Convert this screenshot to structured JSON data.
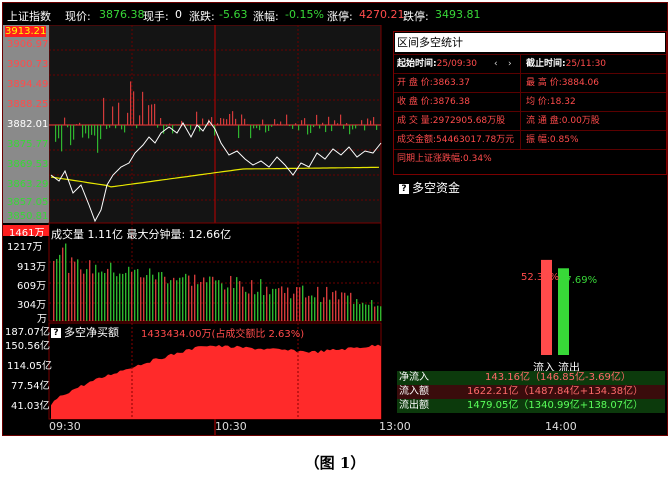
{
  "header": {
    "index_name": "上证指数",
    "price_label": "现价:",
    "price": "3876.38",
    "hand_label": "现手:",
    "hand": "0",
    "change_label": "涨跌:",
    "change": "-5.63",
    "pct_label": "涨幅:",
    "pct": "-0.15%",
    "limit_up_label": "涨停:",
    "limit_up": "4270.21",
    "limit_down_label": "跌停:",
    "limit_down": "3493.81"
  },
  "price_axis": [
    "3913.21",
    "3906.97",
    "3900.73",
    "3894.49",
    "3888.25",
    "3882.01",
    "3875.77",
    "3869.53",
    "3863.29",
    "3857.05",
    "3850.81"
  ],
  "volume_panel": {
    "highlight": "1461万",
    "title": "成交量 1.11亿 最大分钟量: 12.66亿",
    "axis": [
      "1217万",
      "913万",
      "609万",
      "304万",
      "万"
    ]
  },
  "netbuy_panel": {
    "title": "多空净买额",
    "value_text": "1433434.00万(占成交额比 2.63%)",
    "axis": [
      "187.07亿",
      "150.56亿",
      "114.05亿",
      "77.54亿",
      "41.03亿"
    ]
  },
  "time_axis": [
    "09:30",
    "10:30",
    "13:00",
    "14:00"
  ],
  "stats": {
    "title": "区间多空统计",
    "start_label": "起始时间:",
    "start_value": "25/09:30",
    "end_label": "截止时间:",
    "end_value": "25/11:30",
    "open_label": "开 盘 价:",
    "open_value": "3863.37",
    "high_label": "最 高 价:",
    "high_value": "3884.06",
    "close_label": "收 盘 价:",
    "close_value": "3876.38",
    "avg_label": "均     价:",
    "avg_value": "18.32",
    "vol_label": "成 交 量:",
    "vol_value": "2972905.68万股",
    "float_label": "流 通 盘:",
    "float_value": "0.00万股",
    "amount_label": "成交金额:",
    "amount_value": "54463017.78万元",
    "amp_label": "振     幅:",
    "amp_value": "0.85%",
    "sync_label": "同期上证涨跌幅:",
    "sync_value": "0.34%"
  },
  "capital": {
    "title": "多空资金",
    "inflow_pct": "52.31%",
    "outflow_pct": "47.69%",
    "inflow_ratio": 0.5231,
    "outflow_ratio": 0.4769,
    "inflow_bar_label": "流入",
    "outflow_bar_label": "流出",
    "net_label": "净流入",
    "net_value": "143.16亿（146.85亿-3.69亿）",
    "in_label": "流入额",
    "in_value": "1622.21亿（1487.84亿+134.38亿）",
    "out_label": "流出额",
    "out_value": "1479.05亿（1340.99亿+138.07亿）"
  },
  "caption": "（图 1）",
  "colors": {
    "up": "#ff4b4b",
    "down": "#38d838",
    "avg_line": "#e8e800",
    "price_line": "#ffffff",
    "area": "#ff2a2a"
  }
}
